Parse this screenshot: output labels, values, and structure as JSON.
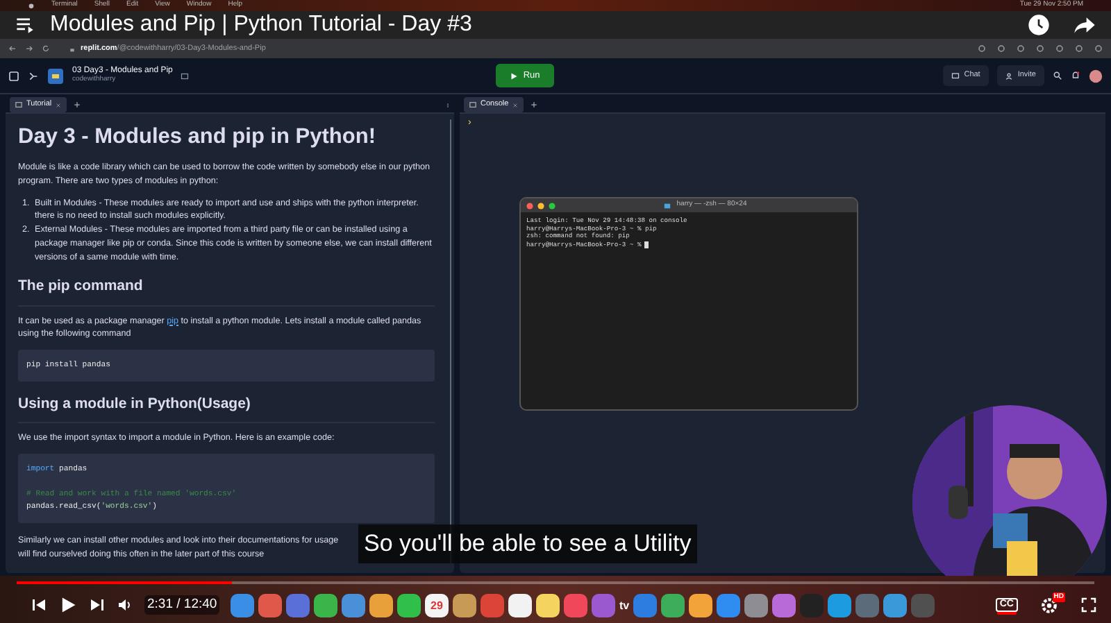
{
  "menubar": {
    "items": [
      "Terminal",
      "Shell",
      "Edit",
      "View",
      "Window",
      "Help"
    ],
    "clock": "Tue 29 Nov 2:50 PM"
  },
  "video": {
    "title": "Modules and Pip | Python Tutorial - Day #3",
    "subtitle": "So you'll be able to see a Utility",
    "progress": {
      "level": 0.2
    },
    "time": "2:31 / 12:40",
    "cc": "CC",
    "captions_on": true,
    "quality": "HD"
  },
  "browser": {
    "url_host": "replit.com",
    "url_path": "/@codewithharry/03-Day3-Modules-and-Pip"
  },
  "replit": {
    "project": "03 Day3 - Modules and Pip",
    "owner": "codewithharry",
    "run": "Run",
    "chat": "Chat",
    "invite": "Invite"
  },
  "left_pane": {
    "tabs": [
      {
        "label": "Tutorial",
        "selected": true
      }
    ],
    "doc": [
      {
        "kind": "h1",
        "text": "Day 3 - Modules and pip in Python!"
      },
      {
        "kind": "p",
        "parts": [
          {
            "kind": "text",
            "text": "Module is like a code library which can be used to borrow the code written by somebody else in our python program. There are two types of modules in python:"
          }
        ]
      },
      {
        "kind": "ol",
        "items": [
          {
            "marker": "1.",
            "text": "Built in Modules - These modules are ready to import and use and ships with the python interpreter. there is no need to install such modules explicitly."
          },
          {
            "marker": "2.",
            "text": "External Modules - These modules are imported from a third party file or can be installed using a package manager like pip or conda. Since this code is written by someone else, we can install different versions of a same module with time."
          }
        ]
      },
      {
        "kind": "h2",
        "text": "The pip command"
      },
      {
        "kind": "p",
        "parts": [
          {
            "kind": "text",
            "text": "It can be used as a package manager "
          },
          {
            "kind": "link",
            "text": "pip"
          },
          {
            "kind": "text",
            "text": " to install a python module. Lets install a module called pandas using the following command"
          }
        ]
      },
      {
        "kind": "code",
        "lines": [
          {
            "kind": "code",
            "tokens": [
              {
                "kind": "plain",
                "text": "pip install pandas"
              }
            ]
          }
        ]
      },
      {
        "kind": "h2",
        "text": "Using a module in Python(Usage)"
      },
      {
        "kind": "p",
        "parts": [
          {
            "kind": "text",
            "text": "We use the import syntax to import a module in Python. Here is an example code:"
          }
        ]
      },
      {
        "kind": "code",
        "lines": [
          {
            "kind": "code",
            "tokens": [
              {
                "kind": "keyword",
                "text": "import"
              },
              {
                "kind": "plain",
                "text": " pandas"
              }
            ]
          },
          {
            "kind": "blank"
          },
          {
            "kind": "code",
            "tokens": [
              {
                "kind": "comment",
                "text": "# Read and work with a file named 'words.csv'"
              }
            ]
          },
          {
            "kind": "code",
            "tokens": [
              {
                "kind": "plain",
                "text": "pandas.read_csv("
              },
              {
                "kind": "string",
                "text": "'words.csv'"
              },
              {
                "kind": "plain",
                "text": ")"
              }
            ]
          }
        ]
      },
      {
        "kind": "lines",
        "lines": [
          "Similarly we can install other modules and look into their documentations for usage",
          "will find ourselved doing this often in the later part of this course"
        ]
      }
    ]
  },
  "right_pane": {
    "tabs": [
      {
        "label": "Console",
        "selected": true
      }
    ],
    "prompt": "›"
  },
  "terminal": {
    "title": "harry — -zsh — 80×24",
    "lines": [
      "Last login: Tue Nov 29 14:48:38 on console",
      "harry@Harrys-MacBook-Pro-3 ~ % pip",
      "zsh: command not found: pip",
      "harry@Harrys-MacBook-Pro-3 ~ % "
    ]
  },
  "dock": [
    {
      "kind": "app",
      "color": "#3a8ee6"
    },
    {
      "kind": "app",
      "color": "#e0584a"
    },
    {
      "kind": "app",
      "color": "#5a6fd8"
    },
    {
      "kind": "app",
      "color": "#3bb54a"
    },
    {
      "kind": "app",
      "color": "#4a90d9"
    },
    {
      "kind": "app",
      "color": "#e8a13a"
    },
    {
      "kind": "app",
      "color": "#2fbf4a"
    },
    {
      "kind": "calendar",
      "text": "29"
    },
    {
      "kind": "app",
      "color": "#c79a55"
    },
    {
      "kind": "app",
      "color": "#db4437"
    },
    {
      "kind": "app",
      "color": "#f2f2f2"
    },
    {
      "kind": "app",
      "color": "#f4d35e"
    },
    {
      "kind": "app",
      "color": "#f0475a"
    },
    {
      "kind": "app",
      "color": "#9b59d0"
    },
    {
      "kind": "tv",
      "text": "tv"
    },
    {
      "kind": "app",
      "color": "#2d7de0"
    },
    {
      "kind": "app",
      "color": "#3cae5a"
    },
    {
      "kind": "app",
      "color": "#f2a43a"
    },
    {
      "kind": "app",
      "color": "#2f8cf0"
    },
    {
      "kind": "app",
      "color": "#8d8d93"
    },
    {
      "kind": "app",
      "color": "#b86bd8"
    },
    {
      "kind": "app",
      "color": "#222222"
    },
    {
      "kind": "app",
      "color": "#1d9be0"
    },
    {
      "kind": "app",
      "color": "#5c6b7a"
    },
    {
      "kind": "app",
      "color": "#3a9ad9"
    },
    {
      "kind": "app",
      "color": "#505050"
    }
  ]
}
